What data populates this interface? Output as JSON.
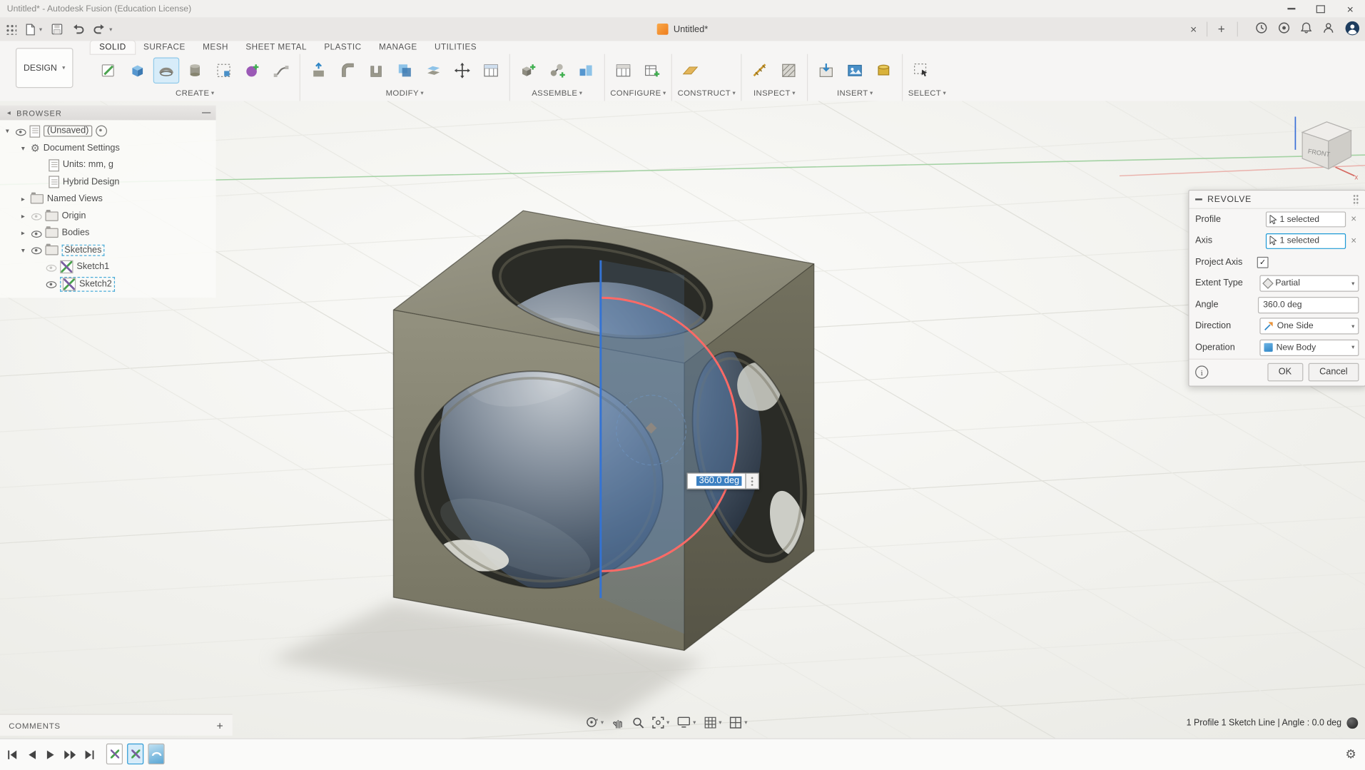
{
  "titlebar": {
    "title": "Untitled* - Autodesk Fusion (Education License)"
  },
  "appbar": {
    "doc_tab": "Untitled*"
  },
  "toolbar": {
    "workspace": "DESIGN",
    "tabs": [
      "SOLID",
      "SURFACE",
      "MESH",
      "SHEET METAL",
      "PLASTIC",
      "MANAGE",
      "UTILITIES"
    ],
    "active_tab": "SOLID",
    "groups": [
      "CREATE",
      "MODIFY",
      "ASSEMBLE",
      "CONFIGURE",
      "CONSTRUCT",
      "INSPECT",
      "INSERT",
      "SELECT"
    ]
  },
  "browser": {
    "header": "BROWSER",
    "items": [
      {
        "label": "(Unsaved)"
      },
      {
        "label": "Document Settings"
      },
      {
        "label": "Units: mm, g"
      },
      {
        "label": "Hybrid Design"
      },
      {
        "label": "Named Views"
      },
      {
        "label": "Origin"
      },
      {
        "label": "Bodies"
      },
      {
        "label": "Sketches"
      },
      {
        "label": "Sketch1"
      },
      {
        "label": "Sketch2"
      }
    ]
  },
  "viewcube": {
    "front": "FRONT",
    "x_label": "x"
  },
  "dialog": {
    "title": "REVOLVE",
    "profile_label": "Profile",
    "profile_value": "1 selected",
    "axis_label": "Axis",
    "axis_value": "1 selected",
    "project_axis_label": "Project Axis",
    "project_axis_checked": "✓",
    "extent_label": "Extent Type",
    "extent_value": "Partial",
    "angle_label": "Angle",
    "angle_value": "360.0 deg",
    "direction_label": "Direction",
    "direction_value": "One Side",
    "operation_label": "Operation",
    "operation_value": "New Body",
    "ok": "OK",
    "cancel": "Cancel"
  },
  "canvas": {
    "angle_value": "360.0 deg"
  },
  "comments": {
    "label": "COMMENTS"
  },
  "status": {
    "text": "1 Profile 1 Sketch Line | Angle : 0.0 deg"
  },
  "colors": {
    "accent": "#0696d7",
    "selection_blue": "#3a7fc1",
    "profile_red": "#ff6a66",
    "axis_blue": "#3473d4"
  }
}
